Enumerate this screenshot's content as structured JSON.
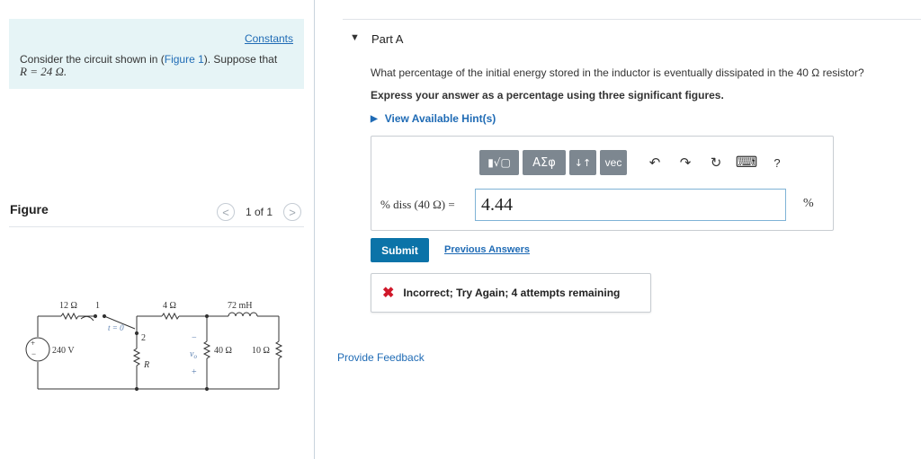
{
  "left": {
    "constants_link": "Constants",
    "problem_prefix": "Consider the circuit shown in (",
    "problem_link": "Figure 1",
    "problem_suffix": "). Suppose that",
    "problem_eq": "R = 24 Ω.",
    "figure_label": "Figure",
    "figure_count": "1 of 1",
    "nav_prev": "<",
    "nav_next": ">"
  },
  "circuit": {
    "r1": "12 Ω",
    "switch_pos1": "1",
    "switch_time": "t = 0",
    "switch_pos2": "2",
    "r2": "4 Ω",
    "inductor": "72 mH",
    "source": "240 V",
    "r_var": "R",
    "vo": "v",
    "vo_sub": "o",
    "r3": "40 Ω",
    "r4": "10 Ω",
    "minus": "−",
    "plus": "+"
  },
  "part": {
    "title": "Part A",
    "question": "What percentage of the initial energy stored in the inductor is eventually dissipated in the 40 Ω resistor?",
    "instruction": "Express your answer as a percentage using three significant figures.",
    "hints": "View Available Hint(s)"
  },
  "toolbar": {
    "templates": "▮√▢",
    "greek": "ΑΣφ",
    "arrows": "↓↑",
    "vec": "vec",
    "undo": "↶",
    "redo": "↷",
    "reset": "↻",
    "keyboard": "⌨",
    "help": "?"
  },
  "answer": {
    "var_label": "% diss (40 Ω) =",
    "value": "4.44",
    "unit": "%"
  },
  "actions": {
    "submit": "Submit",
    "previous_answers": "Previous Answers"
  },
  "feedback": {
    "icon": "✖",
    "text": "Incorrect; Try Again; 4 attempts remaining"
  },
  "footer": {
    "provide_feedback": "Provide Feedback"
  },
  "colors": {
    "link": "#1f6bb5",
    "submit_bg": "#0b73a8",
    "error": "#d0182a",
    "info_bg": "#e6f4f6",
    "toolbar_btn": "#7d8790"
  }
}
